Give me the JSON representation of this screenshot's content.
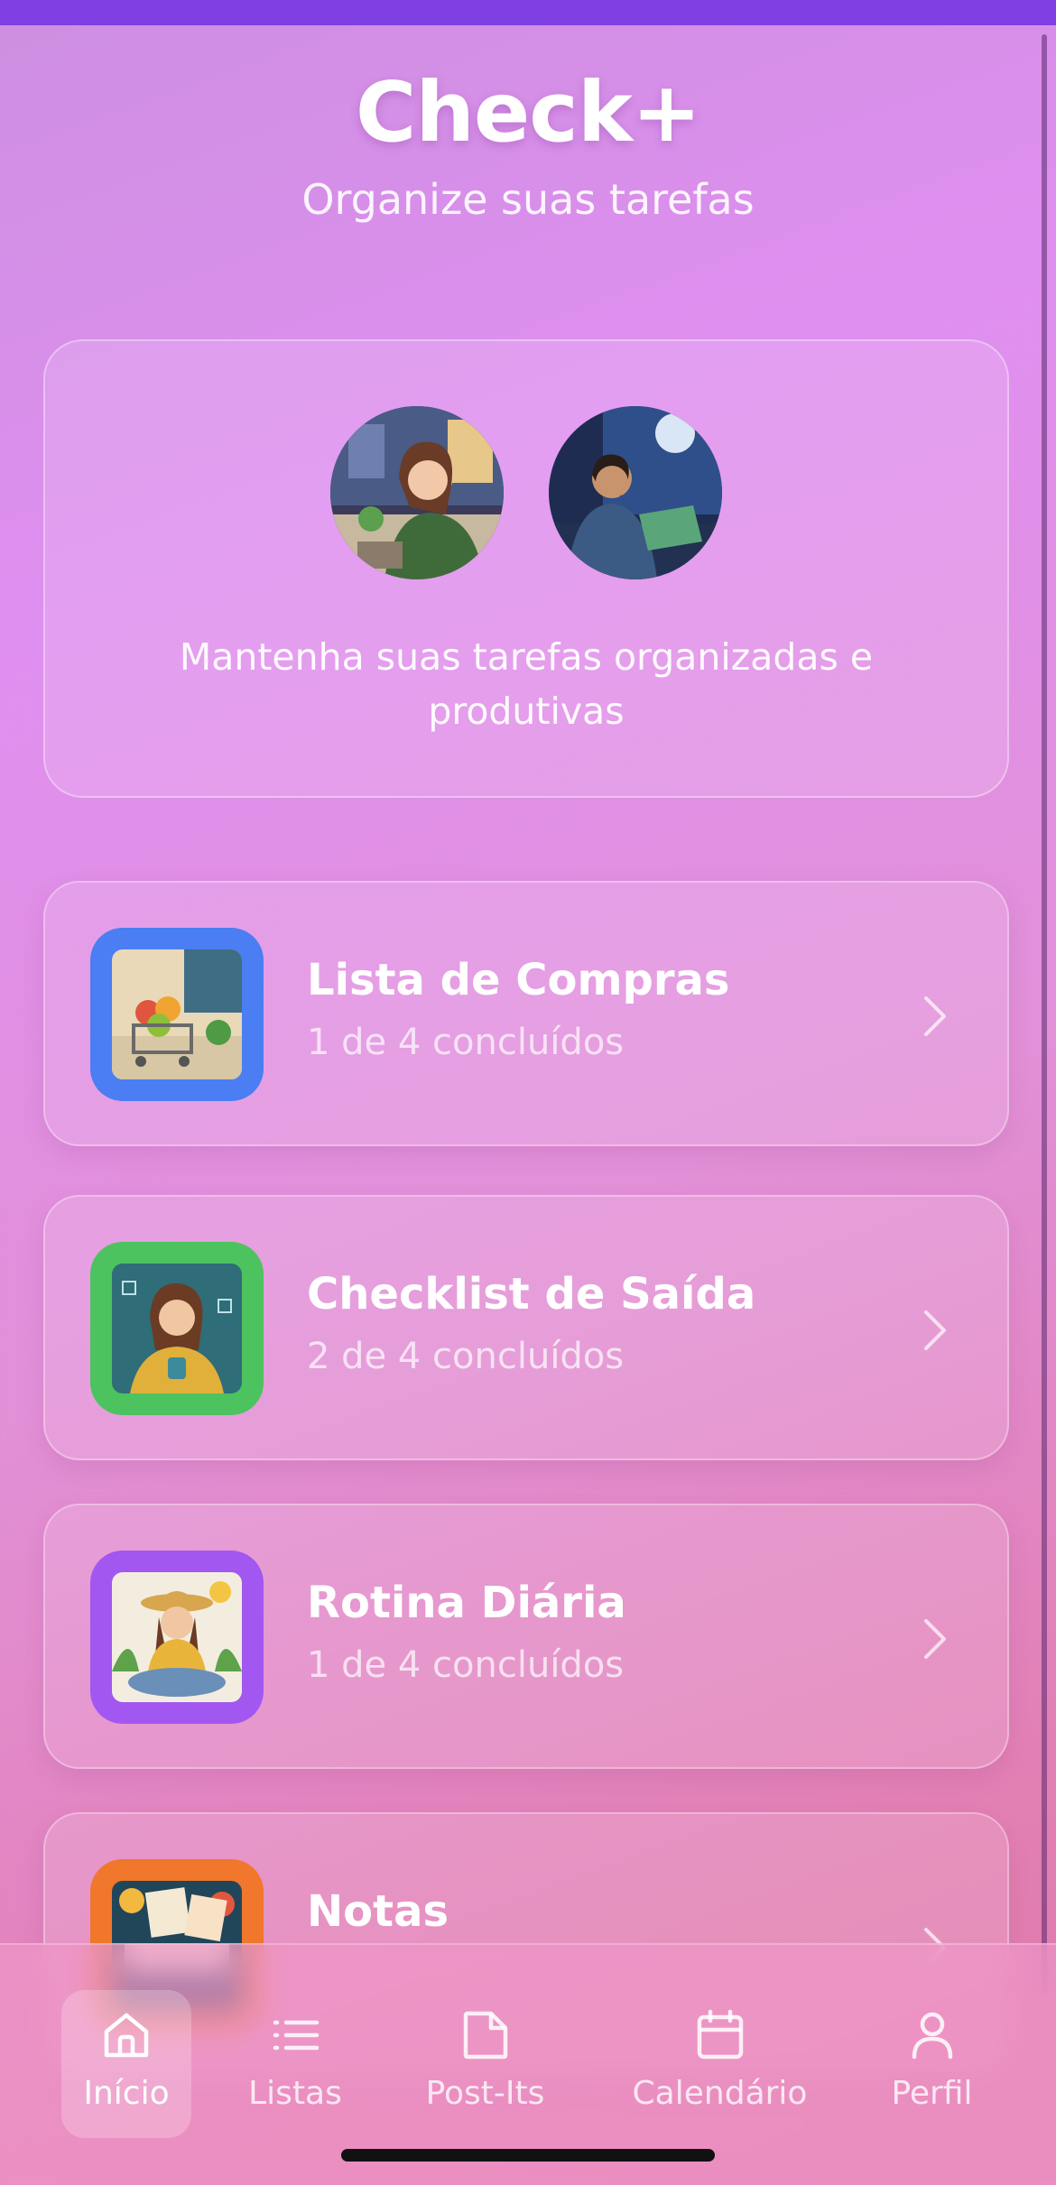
{
  "app": {
    "title": "Check+",
    "subtitle": "Organize suas tarefas"
  },
  "hero": {
    "text": "Mantenha suas tarefas organizadas e produtivas",
    "avatars": [
      "woman-with-headphones-illustration",
      "man-at-laptop-night-illustration"
    ]
  },
  "lists": [
    {
      "title": "Lista de Compras",
      "progress": "1 de 4 concluídos",
      "accent": "#4a7ef2",
      "icon": "shopping-cart-illustration"
    },
    {
      "title": "Checklist de Saída",
      "progress": "2 de 4 concluídos",
      "accent": "#4cc35e",
      "icon": "checklist-girl-illustration"
    },
    {
      "title": "Rotina Diária",
      "progress": "1 de 4 concluídos",
      "accent": "#a257f0",
      "icon": "daily-routine-girl-illustration"
    },
    {
      "title": "Notas",
      "progress": "",
      "accent": "#f0772c",
      "icon": "notes-illustration"
    }
  ],
  "nav": {
    "items": [
      {
        "label": "Início",
        "icon": "home-icon",
        "active": true
      },
      {
        "label": "Listas",
        "icon": "list-icon",
        "active": false
      },
      {
        "label": "Post-Its",
        "icon": "note-icon",
        "active": false
      },
      {
        "label": "Calendário",
        "icon": "calendar-icon",
        "active": false
      },
      {
        "label": "Perfil",
        "icon": "user-icon",
        "active": false
      }
    ]
  },
  "colors": {
    "status_bar": "#7f3fe3",
    "background_start": "#cd8fe0",
    "background_end": "#de79a8"
  }
}
